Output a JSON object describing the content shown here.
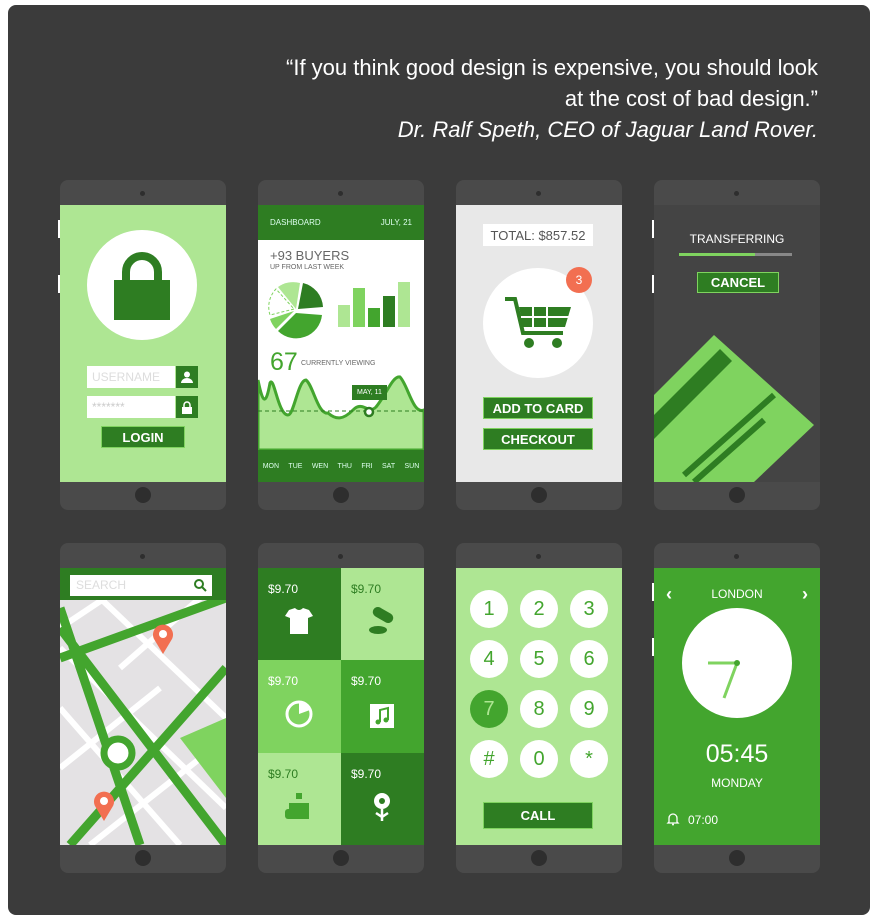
{
  "quote": {
    "line1": "“If you think good design is expensive, you should look",
    "line2": "at the cost of bad design.”",
    "author": "Dr. Ralf Speth, CEO of Jaguar Land Rover."
  },
  "colors": {
    "dark_green": "#2e7d22",
    "mid_green": "#43a52e",
    "light_green": "#aee693",
    "accent_orange": "#f26f51",
    "background": "#3b3b3b"
  },
  "login": {
    "username_placeholder": "USERNAME",
    "password_placeholder": "*******",
    "login_label": "LOGIN",
    "icons": [
      "lock-icon",
      "user-icon",
      "padlock-icon"
    ]
  },
  "dashboard": {
    "title": "DASHBOARD",
    "date": "JULY, 21",
    "buyers": "+93 BUYERS",
    "buyers_sub": "UP FROM LAST WEEK",
    "viewing_count": "67",
    "viewing_label": "CURRENTLY VIEWING",
    "tooltip": "MAY, 11",
    "days": [
      "MON",
      "TUE",
      "WEN",
      "THU",
      "FRI",
      "SAT",
      "SUN"
    ]
  },
  "cart": {
    "total": "TOTAL: $857.52",
    "badge": "3",
    "add_label": "ADD TO CARD",
    "checkout_label": "CHECKOUT"
  },
  "transfer": {
    "title": "TRANSFERRING",
    "progress": 0.67,
    "cancel_label": "CANCEL"
  },
  "map": {
    "search_placeholder": "SEARCH"
  },
  "shop": {
    "items": [
      {
        "price": "$9.70",
        "icon": "tshirt-icon"
      },
      {
        "price": "$9.70",
        "icon": "pills-icon"
      },
      {
        "price": "$9.70",
        "icon": "pizza-icon"
      },
      {
        "price": "$9.70",
        "icon": "music-icon"
      },
      {
        "price": "$9.70",
        "icon": "perfume-icon"
      },
      {
        "price": "$9.70",
        "icon": "flower-icon"
      }
    ]
  },
  "dialer": {
    "keys": [
      "1",
      "2",
      "3",
      "4",
      "5",
      "6",
      "7",
      "8",
      "9",
      "#",
      "0",
      "*"
    ],
    "active": "7",
    "call_label": "CALL"
  },
  "clock": {
    "city": "LONDON",
    "time": "05:45",
    "day": "MONDAY",
    "alarm": "07:00"
  }
}
